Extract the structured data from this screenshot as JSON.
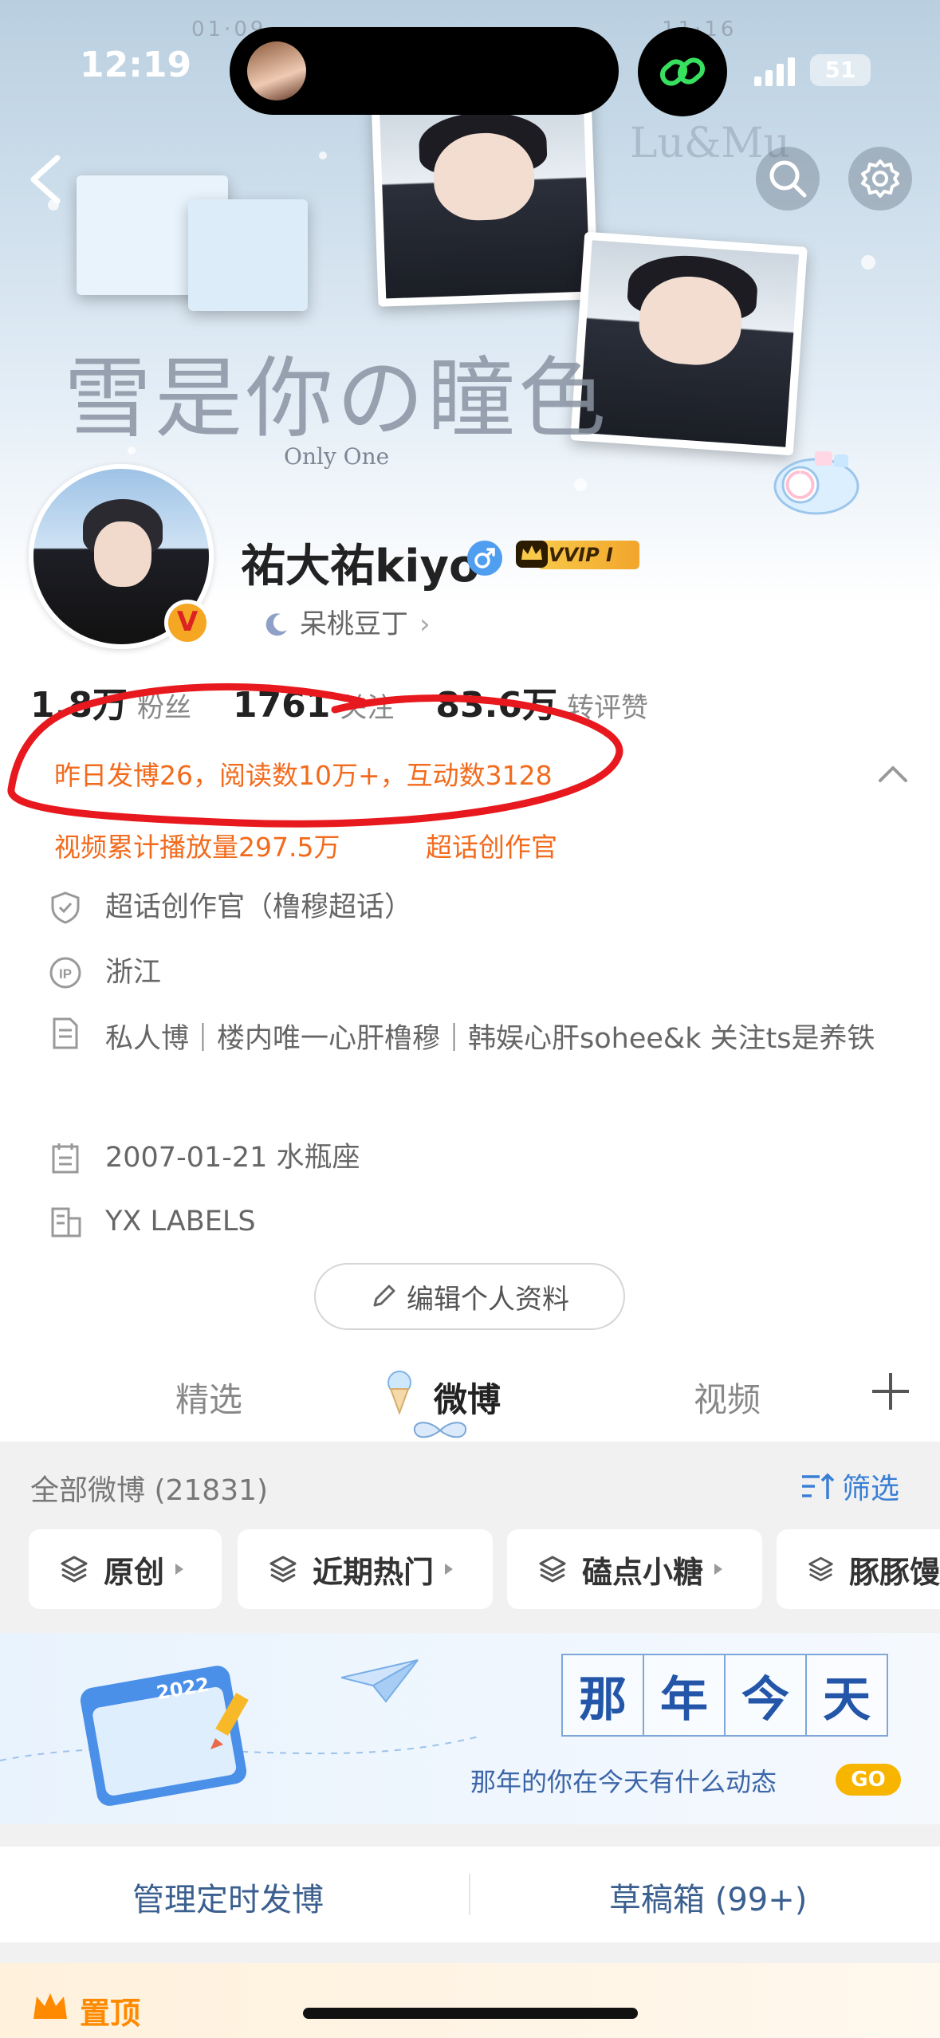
{
  "status_bar": {
    "time": "12:19",
    "battery": "51"
  },
  "banner": {
    "title": "雪是你の瞳色",
    "subtitle": "Only One",
    "deco_text": "Lu&Mu",
    "date_left": "01·09",
    "date_right": "11·16"
  },
  "profile": {
    "nickname": "祐大祐kiyo",
    "vip_label": "VVIP I",
    "fan_tag": "呆桃豆丁",
    "stats": [
      {
        "num": "1.8万",
        "label": "粉丝"
      },
      {
        "num": "1761",
        "label": "关注"
      },
      {
        "num": "83.6万",
        "label": "转评赞"
      }
    ],
    "highlight_line1": "昨日发博26，阅读数10万+，互动数3128",
    "highlight_line2a": "视频累计播放量297.5万",
    "highlight_line2b": "超话创作官",
    "info": {
      "badge": "超话创作官（橹穆超话）",
      "ip": "浙江",
      "bio": "私人博｜楼内唯一心肝橹穆｜韩娱心肝sohee&k 关注ts是养铁",
      "birthday": "2007-01-21 水瓶座",
      "company": "YX LABELS"
    },
    "edit_button": "编辑个人资料"
  },
  "tabs": {
    "items": [
      "精选",
      "微博",
      "视频"
    ],
    "active": "微博"
  },
  "feed": {
    "all_label": "全部微博 (21831)",
    "filter_label": "筛选",
    "chips": [
      "原创",
      "近期热门",
      "磕点小糖",
      "豚豚馒"
    ]
  },
  "memory": {
    "year": "2022",
    "grid": [
      "那",
      "年",
      "今",
      "天"
    ],
    "subtitle": "那年的你在今天有什么动态",
    "go": "GO"
  },
  "actions": {
    "scheduled": "管理定时发博",
    "drafts": "草稿箱 (99+)"
  },
  "pinned": {
    "label": "置顶"
  },
  "colors": {
    "accent_orange": "#f26b1d",
    "link_blue": "#3a7fd5",
    "annotation_red": "#e8191e"
  }
}
